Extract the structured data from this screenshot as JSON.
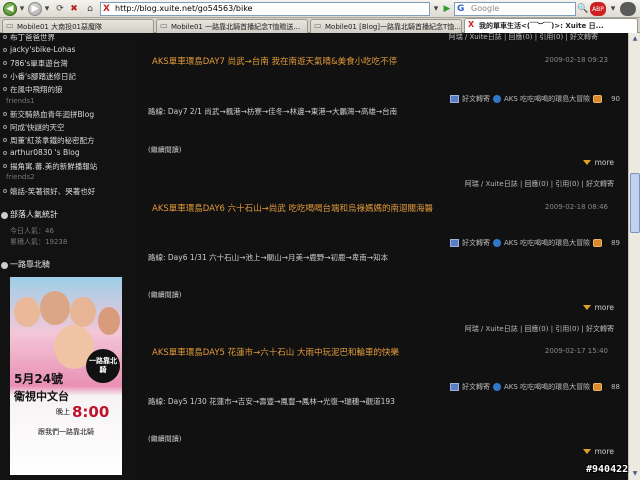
{
  "browser": {
    "url": "http://blog.xuite.net/go54563/bike",
    "search_placeholder": "Google",
    "tabs": [
      {
        "label": "Mobile01 大南投01惡魔隊"
      },
      {
        "label": "Mobile01 一路靠北騎首播紀念T恤贈送..."
      },
      {
        "label": "Mobile01 [Blog]一路靠北騎首播紀念T恤..."
      },
      {
        "label": "我的單車生活<(￣︶￣)>: Xuite 日..."
      }
    ]
  },
  "sidebar": {
    "links_top": [
      {
        "label": "布丁爸爸世界"
      },
      {
        "label": "jacky'sbike-Lohas"
      },
      {
        "label": "786's單車遊台灣"
      },
      {
        "label": "小番's腳踏迷修日記"
      },
      {
        "label": "在風中飛翔的狼"
      }
    ],
    "section_friends1": "friends1",
    "links_friends1": [
      {
        "label": "新交騎熱血青年迴拼Blog"
      },
      {
        "label": "阿成'快謎的天空"
      },
      {
        "label": "周董'紅茶拿鐵的秘密配方"
      },
      {
        "label": "arthur0830 's Blog"
      },
      {
        "label": "揚角寓.蕃.美的新鮮播報站"
      }
    ],
    "section_friends2": "friends2",
    "links_friends2": [
      {
        "label": "嬉話-笑著很好、哭著也好"
      }
    ],
    "stats": {
      "heading": "部落人氣統計",
      "today": "今日人氣：46",
      "total": "累積人氣：19238"
    },
    "promo": {
      "heading": "一路靠北騎",
      "badge": "一路靠北騎",
      "date": "5月24號",
      "channel": "衛視中文台",
      "evening": "晚上",
      "time": "8:00",
      "tagline": "跟我們一路靠北騎"
    }
  },
  "posts": [
    {
      "top_meta": "阿瑞 / Xuite日誌 | 回應(0) | 引用(0) | 好文轉寄",
      "title": "AKS單車環島DAY7 尚武→台南 我在南遊天氣晴&美食小吃吃不停",
      "date": "2009-02-18 09:23",
      "recommend": "好文轉寄",
      "source": "AKS 吃吃喝喝的環島大冒險",
      "count": "90",
      "route": "路線: Day7 2/1 尚武→楓港→枋寮→佳冬→林邊→東港→大鵬灣→高雄→台南",
      "read_more": "(繼續閱讀)",
      "more": "more",
      "meta": "阿瑞 / Xuite日誌 | 回應(0) | 引用(0) | 好文轉寄"
    },
    {
      "title": "AKS單車環島DAY6 六十石山→尚武 吃吃喝喝台端和烏祿媽媽的南迴關海醫",
      "date": "2009-02-18 08:46",
      "recommend": "好文轉寄",
      "source": "AKS 吃吃喝喝的環島大冒險",
      "count": "89",
      "route": "路線: Day6 1/31 六十石山→池上→關山→月美→鹿野→初鹿→卑南→知本",
      "read_more": "(繼續閱讀)",
      "more": "more",
      "meta": "阿瑞 / Xuite日誌 | 回應(0) | 引用(0) | 好文轉寄"
    },
    {
      "title": "AKS單車環島DAY5 花蓮市→六十石山 大雨中玩泥巴和輪車的快樂",
      "date": "2009-02-17 15:40",
      "recommend": "好文轉寄",
      "source": "AKS 吃吃喝喝的環島大冒險",
      "count": "88",
      "route": "路線: Day5 1/30 花蓮市→吉安→壽豐→鳳豐→鳳林→光復→瑞穗→觀道193",
      "read_more": "(繼續閱讀)",
      "more": "more"
    }
  ],
  "watermark": "#940422"
}
